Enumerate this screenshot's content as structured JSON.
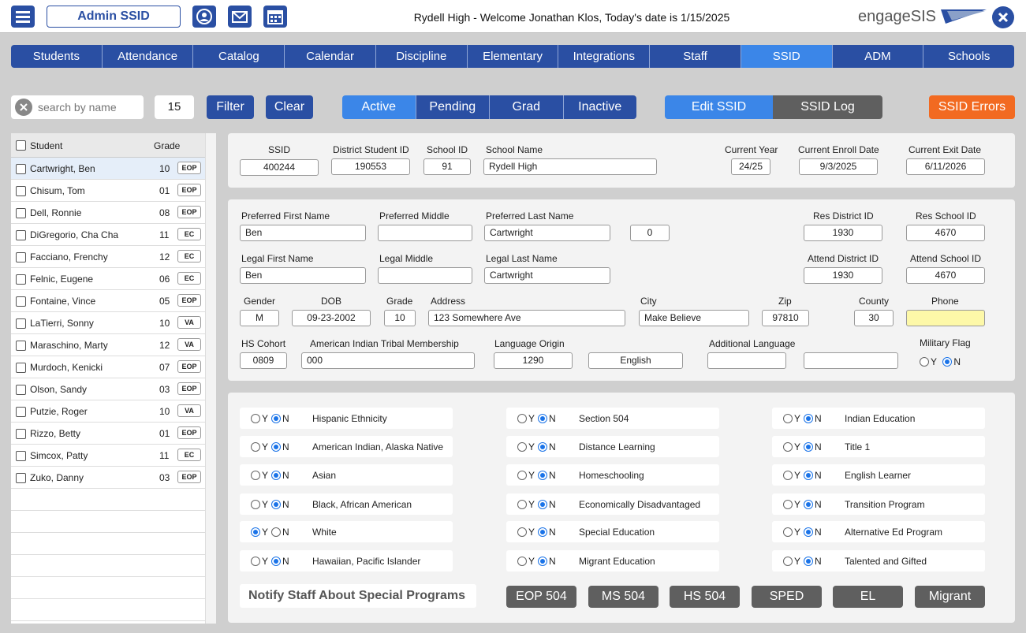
{
  "header": {
    "app_title": "Admin SSID",
    "welcome": "Rydell High - Welcome Jonathan Klos, Today's date is 1/15/2025",
    "logo": "engageSIS",
    "icons": [
      "menu-icon",
      "user-icon",
      "mail-icon",
      "calendar-icon",
      "close-icon"
    ]
  },
  "nav": {
    "tabs": [
      "Students",
      "Attendance",
      "Catalog",
      "Calendar",
      "Discipline",
      "Elementary",
      "Integrations",
      "Staff",
      "SSID",
      "ADM",
      "Schools"
    ],
    "active": "SSID"
  },
  "toolbar": {
    "search_placeholder": "search by name",
    "count": "15",
    "filter": "Filter",
    "clear": "Clear",
    "status_tabs": [
      "Active",
      "Pending",
      "Grad",
      "Inactive"
    ],
    "edit_ssid": "Edit SSID",
    "ssid_log": "SSID Log",
    "ssid_errors": "SSID Errors"
  },
  "list": {
    "header_student": "Student",
    "header_grade": "Grade",
    "rows": [
      {
        "name": "Cartwright, Ben",
        "grade": "10",
        "badge": "EOP"
      },
      {
        "name": "Chisum, Tom",
        "grade": "01",
        "badge": "EOP"
      },
      {
        "name": "Dell, Ronnie",
        "grade": "08",
        "badge": "EOP"
      },
      {
        "name": "DiGregorio, Cha Cha",
        "grade": "11",
        "badge": "EC"
      },
      {
        "name": "Facciano, Frenchy",
        "grade": "12",
        "badge": "EC"
      },
      {
        "name": "Felnic, Eugene",
        "grade": "06",
        "badge": "EC"
      },
      {
        "name": "Fontaine, Vince",
        "grade": "05",
        "badge": "EOP"
      },
      {
        "name": "LaTierri, Sonny",
        "grade": "10",
        "badge": "VA"
      },
      {
        "name": "Maraschino, Marty",
        "grade": "12",
        "badge": "VA"
      },
      {
        "name": "Murdoch, Kenicki",
        "grade": "07",
        "badge": "EOP"
      },
      {
        "name": "Olson, Sandy",
        "grade": "03",
        "badge": "EOP"
      },
      {
        "name": "Putzie, Roger",
        "grade": "10",
        "badge": "VA"
      },
      {
        "name": "Rizzo, Betty",
        "grade": "01",
        "badge": "EOP"
      },
      {
        "name": "Simcox, Patty",
        "grade": "11",
        "badge": "EC"
      },
      {
        "name": "Zuko, Danny",
        "grade": "03",
        "badge": "EOP"
      }
    ]
  },
  "ids": {
    "ssid_label": "SSID",
    "ssid": "400244",
    "district_id_label": "District Student ID",
    "district_id": "190553",
    "school_id_label": "School ID",
    "school_id": "91",
    "school_name_label": "School Name",
    "school_name": "Rydell High",
    "current_year_label": "Current Year",
    "current_year": "24/25",
    "enroll_date_label": "Current Enroll Date",
    "enroll_date": "9/3/2025",
    "exit_date_label": "Current Exit Date",
    "exit_date": "6/11/2026"
  },
  "demo": {
    "pref_first_label": "Preferred First Name",
    "pref_first": "Ben",
    "pref_middle_label": "Preferred Middle",
    "pref_middle": "",
    "pref_last_label": "Preferred Last Name",
    "pref_last": "Cartwright",
    "suffix": "0",
    "res_district_label": "Res District ID",
    "res_district": "1930",
    "res_school_label": "Res School ID",
    "res_school": "4670",
    "legal_first_label": "Legal First Name",
    "legal_first": "Ben",
    "legal_middle_label": "Legal Middle",
    "legal_middle": "",
    "legal_last_label": "Legal Last Name",
    "legal_last": "Cartwright",
    "attend_district_label": "Attend District ID",
    "attend_district": "1930",
    "attend_school_label": "Attend School ID",
    "attend_school": "4670",
    "gender_label": "Gender",
    "gender": "M",
    "dob_label": "DOB",
    "dob": "09-23-2002",
    "grade_label": "Grade",
    "grade": "10",
    "address_label": "Address",
    "address": "123 Somewhere Ave",
    "city_label": "City",
    "city": "Make Believe",
    "zip_label": "Zip",
    "zip": "97810",
    "county_label": "County",
    "county": "30",
    "phone_label": "Phone",
    "phone": "",
    "cohort_label": "HS Cohort",
    "cohort": "0809",
    "tribal_label": "American Indian Tribal Membership",
    "tribal": "000",
    "lang_origin_label": "Language Origin",
    "lang_code": "1290",
    "lang_name": "English",
    "addl_lang_label": "Additional Language",
    "addl_lang_1": "",
    "addl_lang_2": "",
    "military_label": "Military Flag",
    "military": "N"
  },
  "programs": [
    [
      {
        "label": "Hispanic Ethnicity",
        "value": "N"
      },
      {
        "label": "American Indian, Alaska Native",
        "value": "N"
      },
      {
        "label": "Asian",
        "value": "N"
      },
      {
        "label": "Black, African American",
        "value": "N"
      },
      {
        "label": "White",
        "value": "Y"
      },
      {
        "label": "Hawaiian, Pacific Islander",
        "value": "N"
      }
    ],
    [
      {
        "label": "Section 504",
        "value": "N"
      },
      {
        "label": "Distance Learning",
        "value": "N"
      },
      {
        "label": "Homeschooling",
        "value": "N"
      },
      {
        "label": "Economically Disadvantaged",
        "value": "N"
      },
      {
        "label": "Special Education",
        "value": "N"
      },
      {
        "label": "Migrant Education",
        "value": "N"
      }
    ],
    [
      {
        "label": "Indian Education",
        "value": "N"
      },
      {
        "label": "Title 1",
        "value": "N"
      },
      {
        "label": "English Learner",
        "value": "N"
      },
      {
        "label": "Transition Program",
        "value": "N"
      },
      {
        "label": "Alternative Ed Program",
        "value": "N"
      },
      {
        "label": "Talented and Gifted",
        "value": "N"
      }
    ]
  ],
  "notify": {
    "label": "Notify Staff About Special Programs",
    "buttons": [
      "EOP 504",
      "MS 504",
      "HS 504",
      "SPED",
      "EL",
      "Migrant"
    ]
  },
  "yes": "Y",
  "no": "N"
}
